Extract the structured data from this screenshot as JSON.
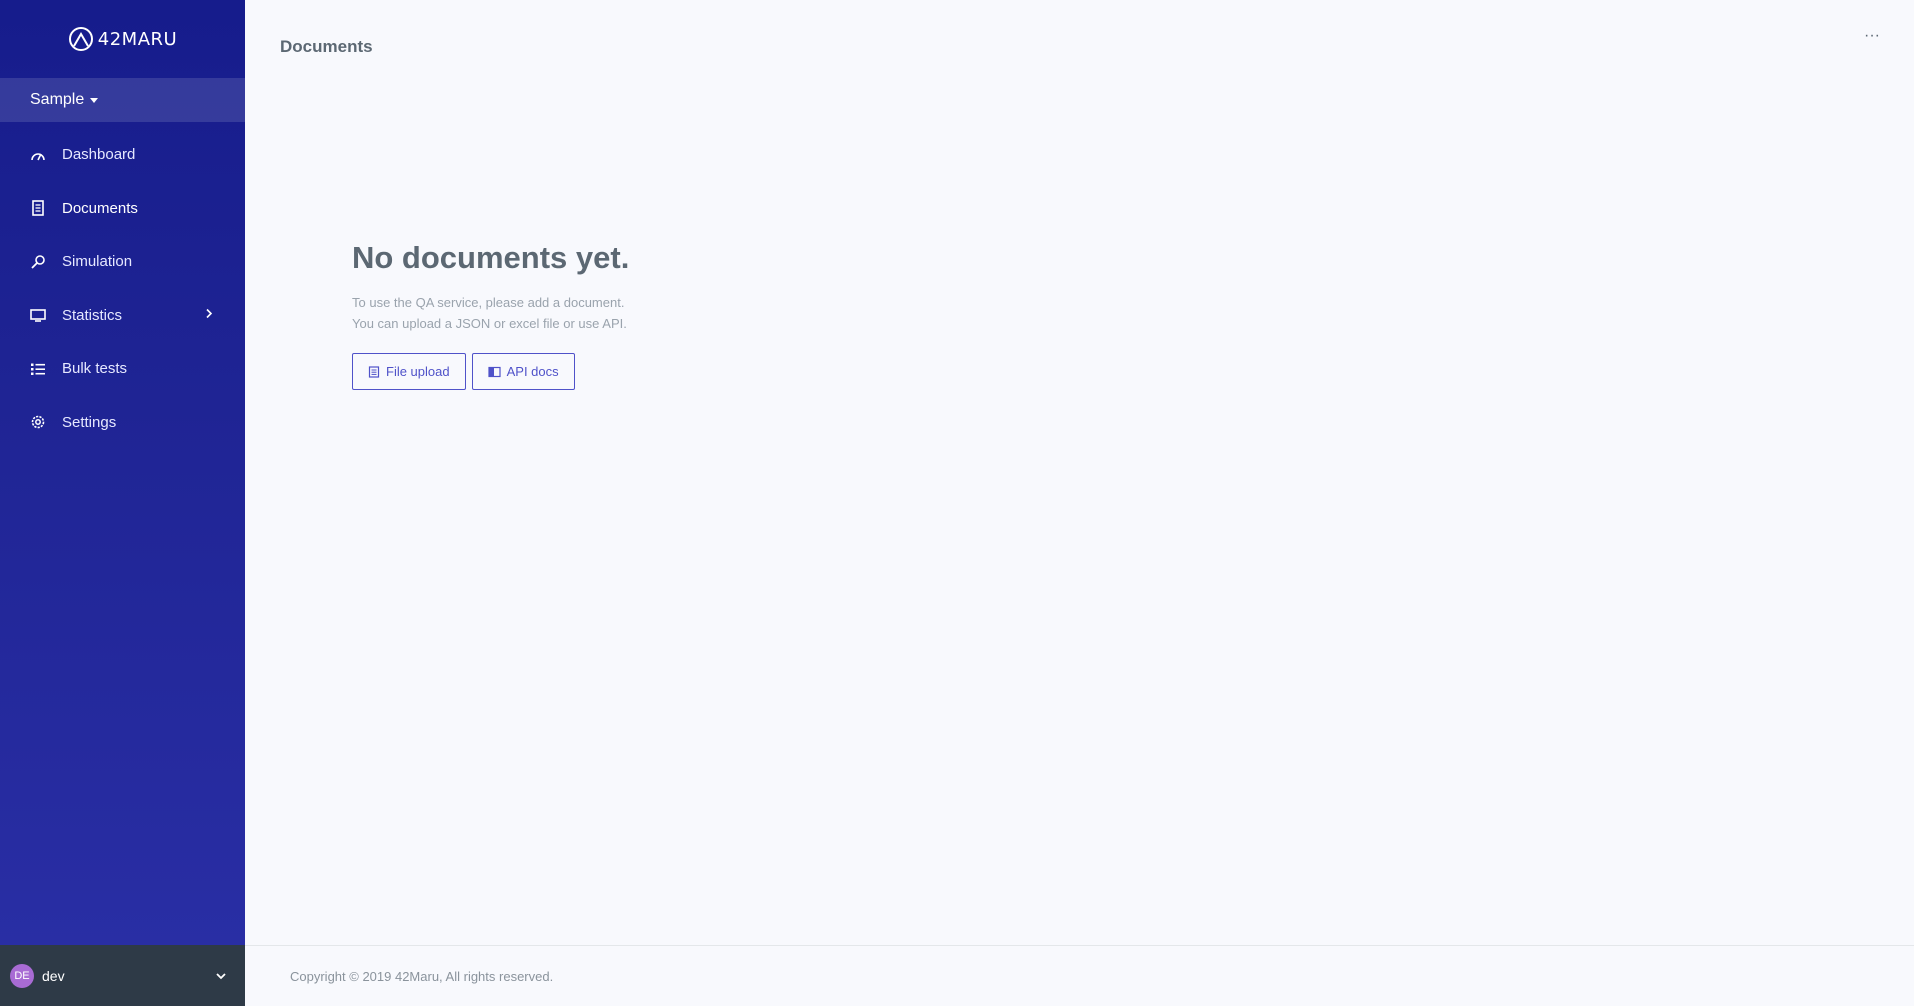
{
  "brand": {
    "name": "42MARU"
  },
  "workspace": {
    "label": "Sample"
  },
  "sidebar": {
    "items": [
      {
        "label": "Dashboard",
        "icon": "speedometer-icon"
      },
      {
        "label": "Documents",
        "icon": "document-icon"
      },
      {
        "label": "Simulation",
        "icon": "magnifier-icon"
      },
      {
        "label": "Statistics",
        "icon": "monitor-icon"
      },
      {
        "label": "Bulk tests",
        "icon": "list-icon"
      },
      {
        "label": "Settings",
        "icon": "gear-icon"
      }
    ]
  },
  "user": {
    "initials": "DE",
    "name": "dev"
  },
  "header": {
    "title": "Documents",
    "more": "···"
  },
  "empty_state": {
    "heading": "No documents yet.",
    "line1": "To use the QA service, please add a document.",
    "line2": "You can upload a JSON or excel file or use API.",
    "upload_label": "File upload",
    "api_label": "API docs"
  },
  "footer": {
    "text": "Copyright © 2019 42Maru, All rights reserved."
  },
  "colors": {
    "sidebar_top": "#161c8c",
    "sidebar_bottom": "#2a2fa6",
    "accent": "#4f52c9",
    "user_bar": "#2e3a47",
    "avatar": "#a86bd4"
  }
}
